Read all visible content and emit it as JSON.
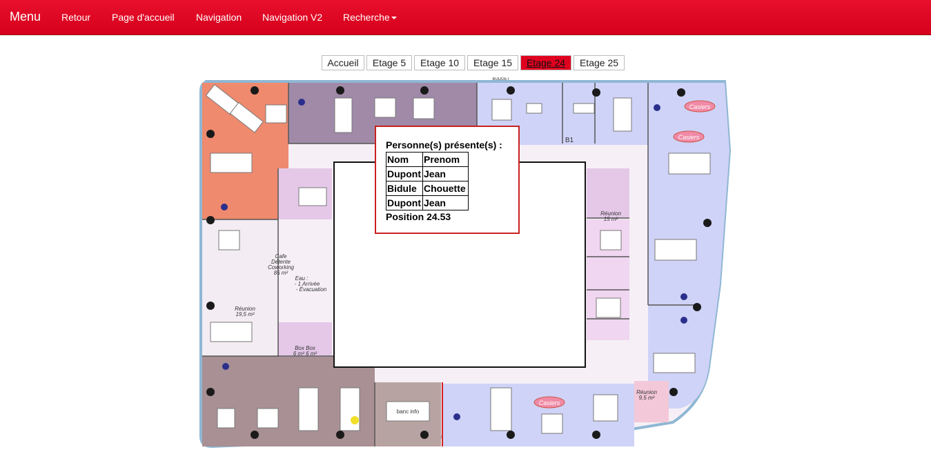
{
  "navbar": {
    "brand": "Menu",
    "links": [
      "Retour",
      "Page d'accueil",
      "Navigation",
      "Navigation V2",
      "Recherche"
    ]
  },
  "floors": {
    "tabs": [
      "Accueil",
      "Etage 5",
      "Etage 10",
      "Etage 15",
      "Etage 24",
      "Etage 25"
    ],
    "active": "Etage 24"
  },
  "plan": {
    "labels": {
      "cafe": [
        "Cafe",
        "Détente",
        "Coworking",
        "85 m²"
      ],
      "eau": [
        "Eau :",
        "- 1 Arrivée",
        "- Évacuation"
      ],
      "reunion_left": [
        "Réunion",
        "19,5 m²"
      ],
      "box": [
        "Box  Box",
        "6 m²  6 m²"
      ],
      "reunion_right": [
        "Réunion",
        "15 m²"
      ],
      "reunion_bottom": [
        "Réunion",
        "9,5 m²"
      ],
      "casiers": "Casiers",
      "banc": "banc info",
      "b1": "B1",
      "budget": "BUDGET"
    }
  },
  "popup": {
    "title": "Personne(s) présente(s) :",
    "headers": [
      "Nom",
      "Prenom"
    ],
    "rows": [
      [
        "Dupont",
        "Jean"
      ],
      [
        "Bidule",
        "Chouette"
      ],
      [
        "Dupont",
        "Jean"
      ]
    ],
    "position": "Position 24.53"
  },
  "colors": {
    "navbar": "#e0001f",
    "active_tab": "#e0001f",
    "popup_border": "#c9201f",
    "zone_orange": "#ef8a6e",
    "zone_purple": "#a08aa8",
    "zone_blue": "#cfd3f7",
    "zone_brown": "#a89094"
  }
}
